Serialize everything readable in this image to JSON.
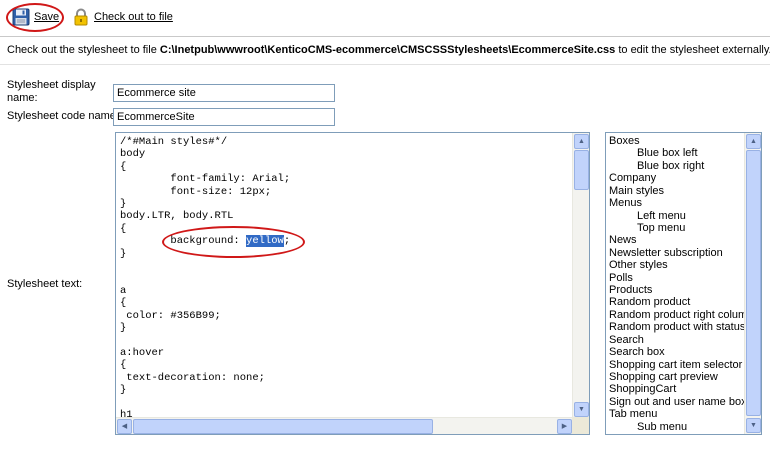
{
  "toolbar": {
    "save_label": "Save",
    "checkout_label": "Check out to file"
  },
  "info": {
    "prefix": "Check out the stylesheet to file ",
    "path": "C:\\Inetpub\\wwwroot\\KenticoCMS-ecommerce\\CMSCSSStylesheets\\EcommerceSite.css",
    "suffix": " to edit the stylesheet externally."
  },
  "form": {
    "display_name_label": "Stylesheet display name:",
    "display_name_value": "Ecommerce site",
    "code_name_label": "Stylesheet code name:",
    "code_name_value": "EcommerceSite",
    "text_label": "Stylesheet text:"
  },
  "code": {
    "before_highlight": "/*#Main styles#*/\nbody\n{\n        font-family: Arial;\n        font-size: 12px;\n}\nbody.LTR, body.RTL\n{\n        background: ",
    "highlight": "yellow",
    "after_highlight": ";\n}\n\n\na\n{\n color: #356B99;\n}\n\na:hover\n{\n text-decoration: none;\n}\n\nh1\n{"
  },
  "style_list": [
    {
      "label": "Boxes",
      "indent": false
    },
    {
      "label": "Blue box left",
      "indent": true
    },
    {
      "label": "Blue box right",
      "indent": true
    },
    {
      "label": "Company",
      "indent": false
    },
    {
      "label": "Main styles",
      "indent": false
    },
    {
      "label": "Menus",
      "indent": false
    },
    {
      "label": "Left menu",
      "indent": true
    },
    {
      "label": "Top menu",
      "indent": true
    },
    {
      "label": "News",
      "indent": false
    },
    {
      "label": "Newsletter subscription",
      "indent": false
    },
    {
      "label": "Other styles",
      "indent": false
    },
    {
      "label": "Polls",
      "indent": false
    },
    {
      "label": "Products",
      "indent": false
    },
    {
      "label": "Random product",
      "indent": false
    },
    {
      "label": "Random product right column",
      "indent": false
    },
    {
      "label": "Random product with status",
      "indent": false
    },
    {
      "label": "Search",
      "indent": false
    },
    {
      "label": "Search box",
      "indent": false
    },
    {
      "label": "Shopping cart item selector",
      "indent": false
    },
    {
      "label": "Shopping cart preview",
      "indent": false
    },
    {
      "label": "ShoppingCart",
      "indent": false
    },
    {
      "label": "Sign out and user name box",
      "indent": false
    },
    {
      "label": "Tab menu",
      "indent": false
    },
    {
      "label": "Sub menu",
      "indent": true
    }
  ],
  "colors": {
    "annotation": "#d01818",
    "selection": "#316ac5",
    "input_border": "#7f9db9"
  },
  "icons": {
    "save": "floppy-disk-icon",
    "checkout": "padlock-icon"
  }
}
